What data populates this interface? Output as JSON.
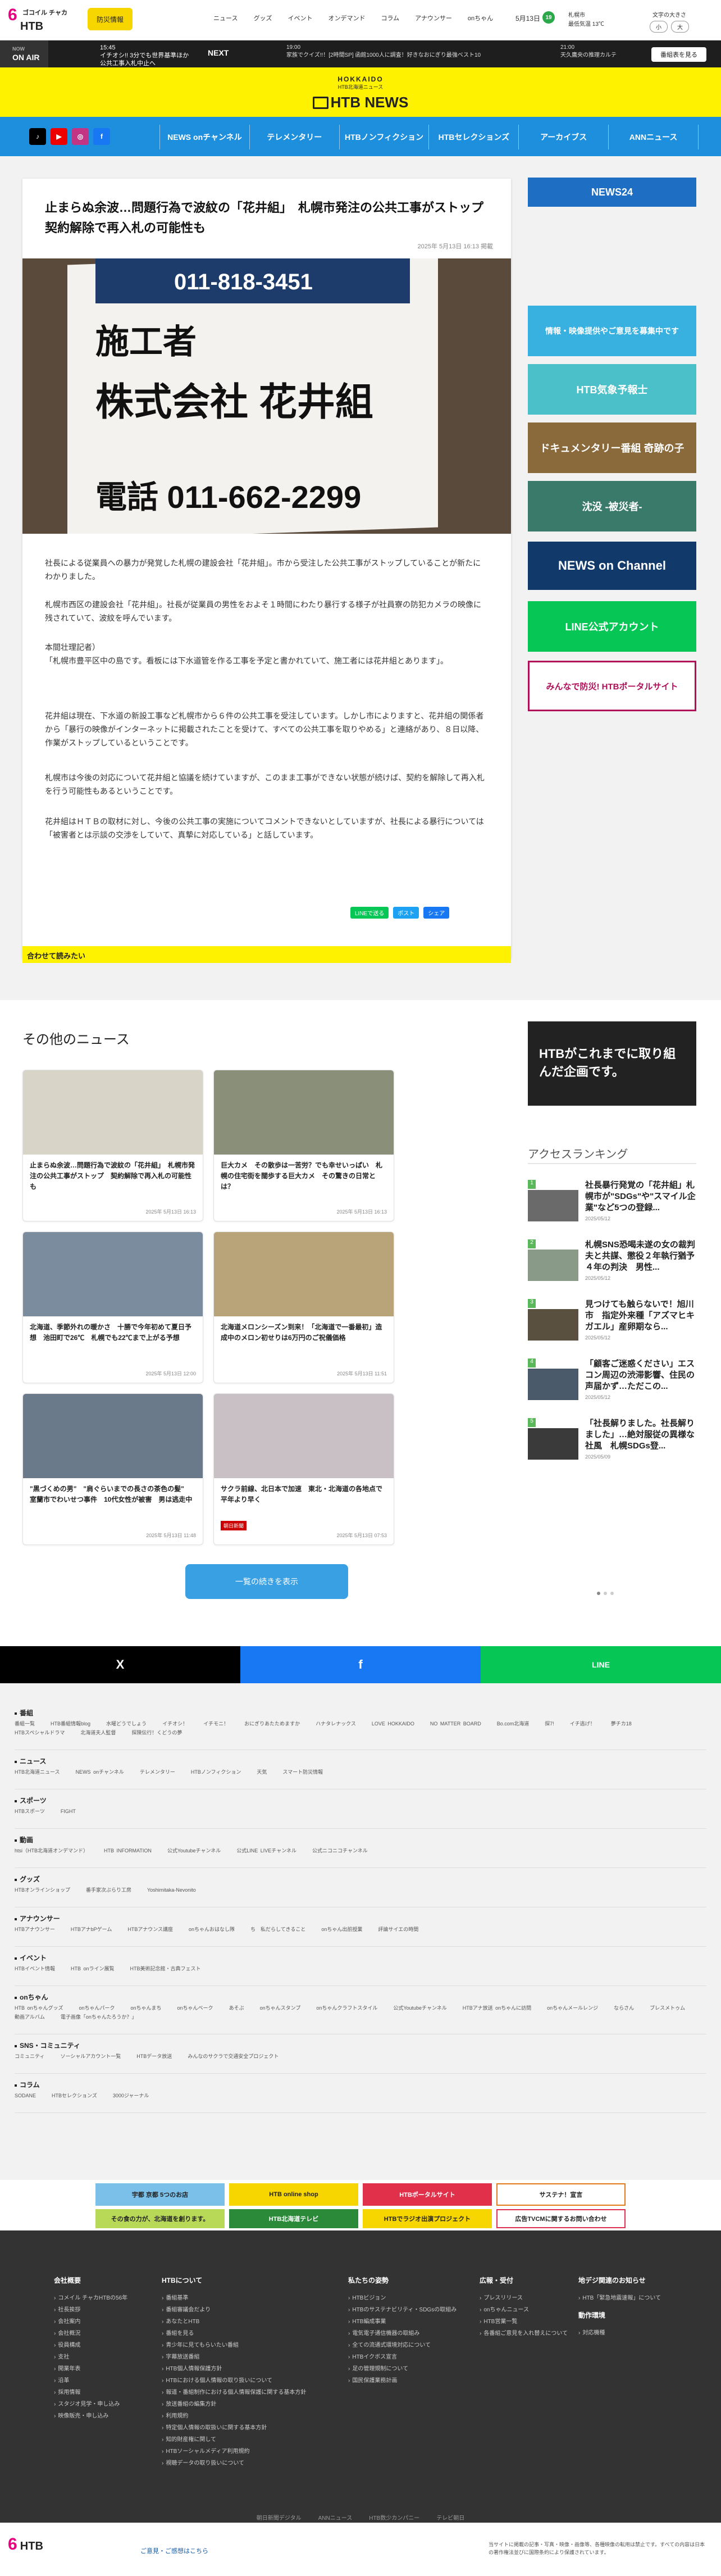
{
  "header": {
    "logo_top": "ゴコイル チャカ",
    "logo_main": "HTB",
    "disaster_label": "防災情報",
    "nav": [
      "ニュース",
      "グッズ",
      "イベント",
      "オンデマンド",
      "コラム",
      "アナウンサー",
      "onちゃん"
    ],
    "date": "5月13日",
    "weather_badge": "19",
    "weather_city": "札幌市",
    "weather_info": "最低気温 13℃",
    "fontsize_label": "文字の大きさ",
    "fontsize_small": "小",
    "fontsize_large": "大"
  },
  "onair": {
    "now_label": "NOW",
    "now_main": "ON AIR",
    "current_time": "15:45",
    "current_program": "イチオシ!! 3分でも世界基準ほか 公共工事入札中止へ",
    "next_label": "NEXT",
    "next_time": "19:00",
    "next_program": "家族でクイズ!!！[2時間SP] 函館1000人に調査！好きなおにぎり最強ベスト10",
    "next2_time": "21:00",
    "next2_program": "天久鷹央の推理カルテ",
    "timetable_btn": "番組表を見る"
  },
  "brand": {
    "small": "HOKKAIDO",
    "sub": "HTB北海道ニュース",
    "main": "HTB NEWS"
  },
  "nav_links": [
    "NEWS onチャンネル",
    "テレメンタリー",
    "HTBノンフィクション",
    "HTBセレクションズ",
    "アーカイブス",
    "ANNニュース"
  ],
  "article": {
    "title": "止まらぬ余波…問題行為で波紋の「花井組」　札幌市発注の公共工事がストップ　契約解除で再入札の可能性も",
    "date": "2025年 5月13日 16:13 掲載",
    "photo_texts": [
      "011-818-3451",
      "施工者",
      "株式会社 花井組",
      "電話 011-662-2299"
    ],
    "paragraphs": [
      "社長による従業員への暴力が発覚した札幌の建設会社「花井組」。市から受注した公共工事がストップしていることが新たにわかりました。",
      "札幌市西区の建設会社「花井組」。社長が従業員の男性をおよそ１時間にわたり暴行する様子が社員寮の防犯カメラの映像に残されていて、波紋を呼んでいます。",
      "本間壮理記者）\n「札幌市豊平区中の島です。看板には下水道管を作る工事を予定と書かれていて、施工者には花井組とあります」。",
      "花井組は現在、下水道の新設工事など札幌市から６件の公共工事を受注しています。しかし市によりますと、花井組の関係者から「暴行の映像がインターネットに掲載されたことを受けて、すべての公共工事を取りやめる」と連絡があり、８日以降、作業がストップしているということです。",
      "札幌市は今後の対応について花井組と協議を続けていますが、このまま工事ができない状態が続けば、契約を解除して再入札を行う可能性もあるということです。",
      "花井組はＨＴＢの取材に対し、今後の公共工事の実施についてコメントできないとしていますが、社長による暴行については「被害者とは示談の交渉をしていて、真摯に対応している」と話しています。"
    ],
    "share": [
      "LINEで送る",
      "ポスト",
      "シェア"
    ],
    "related_label": "合わせて読みたい"
  },
  "sidebar_banners": [
    "NEWS24",
    "情報・映像提供やご意見を募集中です",
    "HTB気象予報士",
    "ドキュメンタリー番組 奇跡の子",
    "沈没 -被災者-",
    "NEWS on Channel",
    "LINE公式アカウント",
    "みんなで防災! HTBポータルサイト"
  ],
  "other_news": {
    "title": "その他のニュース",
    "items": [
      {
        "text": "止まらぬ余波…問題行為で波紋の「花井組」　札幌市発注の公共工事がストップ　契約解除で再入札の可能性も",
        "date": "2025年 5月13日 16:13"
      },
      {
        "text": "巨大カメ　その散歩は一苦労？でも幸せいっぱい　札幌の住宅街を闊歩する巨大カメ　その驚きの日常とは？",
        "date": "2025年 5月13日 16:13"
      },
      {
        "text": "北海道、季節外れの暖かさ　十勝で今年初めて夏日予想　池田町で26℃　札幌でも22℃まで上がる予想",
        "date": "2025年 5月13日 12:00"
      },
      {
        "text": "北海道メロンシーズン到来！「北海道で一番最初」造成中のメロン初せりは6万円のご祝儀価格",
        "date": "2025年 5月13日 11:51"
      },
      {
        "text": "\"黒づくめの男\"　\"肩ぐらいまでの長さの茶色の髪\"　室蘭市でわいせつ事件　10代女性が被害　男は逃走中",
        "date": "2025年 5月13日 11:48"
      },
      {
        "text": "サクラ前線、北日本で加速　東北・北海道の各地点で平年より早く",
        "date": "2025年 5月13日 07:53"
      }
    ],
    "more_btn": "一覧の続きを表示",
    "tag_label": "朝日新聞"
  },
  "ad_black": "HTBがこれまでに取り組んだ企画です。",
  "ranking": {
    "title": "アクセスランキング",
    "items": [
      {
        "rank": "1",
        "text": "社長暴行発覚の「花井組」札幌市が\"SDGs\"や\"スマイル企業\"など5つの登録...",
        "date": "2025/05/12"
      },
      {
        "rank": "2",
        "text": "札幌SNS恐喝未遂の女の裁判　夫と共謀、懲役２年執行猶予４年の判決　男性...",
        "date": "2025/05/12"
      },
      {
        "rank": "3",
        "text": "見つけても触らないで！旭川市　指定外来種「アズマヒキガエル」産卵期なら...",
        "date": "2025/05/12"
      },
      {
        "rank": "4",
        "text": "「顧客ご迷惑ください」エスコン周辺の渋滞影響、住民の声届かず…ただこの...",
        "date": "2025/05/12"
      },
      {
        "rank": "5",
        "text": "「社長解りました。社長解りました」…絶対服従の異様な社風　札幌SDGs登...",
        "date": "2025/05/09"
      }
    ]
  },
  "share_bar": [
    "X",
    "f",
    "LINE"
  ],
  "sitemap": {
    "sections": [
      {
        "title": "番組",
        "links": [
          "番組一覧",
          "HTB番組情報blog",
          "水曜どうでしょう",
          "イチオシ！",
          "イチモニ！",
          "おにぎりあたためますか",
          "ハナタレナックス",
          "LOVE HOKKAIDO",
          "NO MATTER BOARD",
          "Bo.com北海道",
          "探7!",
          "イチ逃げ！",
          "夢チカ18",
          "HTBスペシャルドラマ",
          "北海道夫人監督",
          "探険伝行！くどうの夢"
        ]
      },
      {
        "title": "ニュース",
        "links": [
          "HTB北海道ニュース",
          "NEWS onチャンネル",
          "テレメンタリー",
          "HTBノンフィクション",
          "天気",
          "スマート防災情報"
        ]
      },
      {
        "title": "スポーツ",
        "links": [
          "HTBスポーツ",
          "FIGHT"
        ]
      },
      {
        "title": "動画",
        "links": [
          "htsi（HTB北海道オンデマンド）",
          "HTB INFORMATION",
          "公式Youtubeチャンネル",
          "公式LINE LIVEチャンネル",
          "公式ニコニコチャンネル"
        ]
      },
      {
        "title": "グッズ",
        "links": [
          "HTBオンラインショップ",
          "番手家次ぶらり工房",
          "Yoshimitaka-Nevonito"
        ]
      },
      {
        "title": "アナウンサー",
        "links": [
          "HTBアナウンサー",
          "HTBアナbPゲーム",
          "HTBアナウンス講座",
          "onちゃんおはなし隊",
          "ち　私だらしてきること",
          "onちゃん出前授業",
          "評論サイエの時間"
        ]
      },
      {
        "title": "イベント",
        "links": [
          "HTBイベント情報",
          "HTB onライン展覧",
          "HTB美術記念館・古典フェスト"
        ]
      },
      {
        "title": "onちゃん",
        "links": [
          "HTB onちゃんグッズ",
          "onちゃんパーク",
          "onちゃんまち",
          "onちゃんベーク",
          "あそぶ",
          "onちゃんスタンプ",
          "onちゃんクラフトスタイル",
          "公式Youtubeチャンネル",
          "HTBアナ放送 onちゃんに訪問",
          "onちゃんメールレンジ",
          "ならさん",
          "ブレスメトゥム",
          "動画アルバム",
          "電子画像「onちゃんたろうか？」"
        ]
      },
      {
        "title": "SNS・コミュニティ",
        "links": [
          "コミュニティ",
          "ソーシャルアカウント一覧",
          "HTBデータ放送",
          "みんなのサクラで交通安全プロジェクト"
        ]
      },
      {
        "title": "コラム",
        "links": [
          "SODANE",
          "HTBセレクションズ",
          "3000ジャーナル"
        ]
      }
    ]
  },
  "footer_ads": [
    "宇都 京都 5つのお店",
    "HTB online shop",
    "HTBポータルサイト",
    "サステナ！宣言",
    "その食の力が、北海道を創ります。",
    "HTB北海道テレビ",
    "HTBでラジオ出演プロジェクト",
    "広告TVCMに関するお問い合わせ"
  ],
  "footer": {
    "cols": [
      {
        "title": "会社概要",
        "items": [
          "コメイル チャカHTBの56年",
          "社長挨拶",
          "会社案内",
          "会社概況",
          "役員構成",
          "支社",
          "開業年表",
          "沿革",
          "採用情報",
          "スタジオ見学・申し込み",
          "映像販売・申し込み"
        ]
      },
      {
        "title": "HTBについて",
        "items": [
          "番組基準",
          "番組審議会だより",
          "あなたとHTB",
          "番組を見る",
          "青少年に見てもらいたい番組",
          "字幕放送番組",
          "HTB個人情報保護方針",
          "HTBにおける個人情報の取り扱いについて",
          "報道・番組制作における個人情報保護に関する基本方針",
          "放送番組の編集方針",
          "利用規約",
          "特定個人情報の取扱いに関する基本方針",
          "知的財産権に関して",
          "HTBソーシャルメディア利用規約",
          "視聴データの取り扱いについて"
        ]
      },
      {
        "title": "私たちの姿勢",
        "items": [
          "HTBビジョン",
          "HTBのサステナビリティ・SDGsの取組み",
          "HTB編成事業",
          "電気電子通信機器の取組み",
          "全ての流通式環境対応について",
          "HTBイクボス宣言",
          "足の管理規制について",
          "国民保護業務計画"
        ]
      },
      {
        "title": "広報・受付",
        "items": [
          "プレスリリース",
          "onちゃんニュース",
          "HTB営業一覧",
          "各番組ご意見を入れ替えについて"
        ]
      },
      {
        "title": "地デジ関連のお知らせ",
        "items": [
          "HTB「緊急地震速報」について"
        ],
        "title2": "動作環境",
        "items2": [
          "対応機種"
        ]
      }
    ],
    "bottom_links": [
      "朝日新聞デジタル",
      "ANNニュース",
      "HTB数少カンパニー",
      "テレビ朝日"
    ],
    "copyright_links": "ご意見・ご感想はこちら",
    "notice": "当サイトに掲載の記事・写真・映像・画像等、各種映像の転用は禁止です。すべての内容は日本の著作権法並びに国際条約により保護されています。"
  },
  "colors": {
    "brand_yellow": "#fff200",
    "nav_blue": "#1e8fdc",
    "dark": "#333333"
  }
}
